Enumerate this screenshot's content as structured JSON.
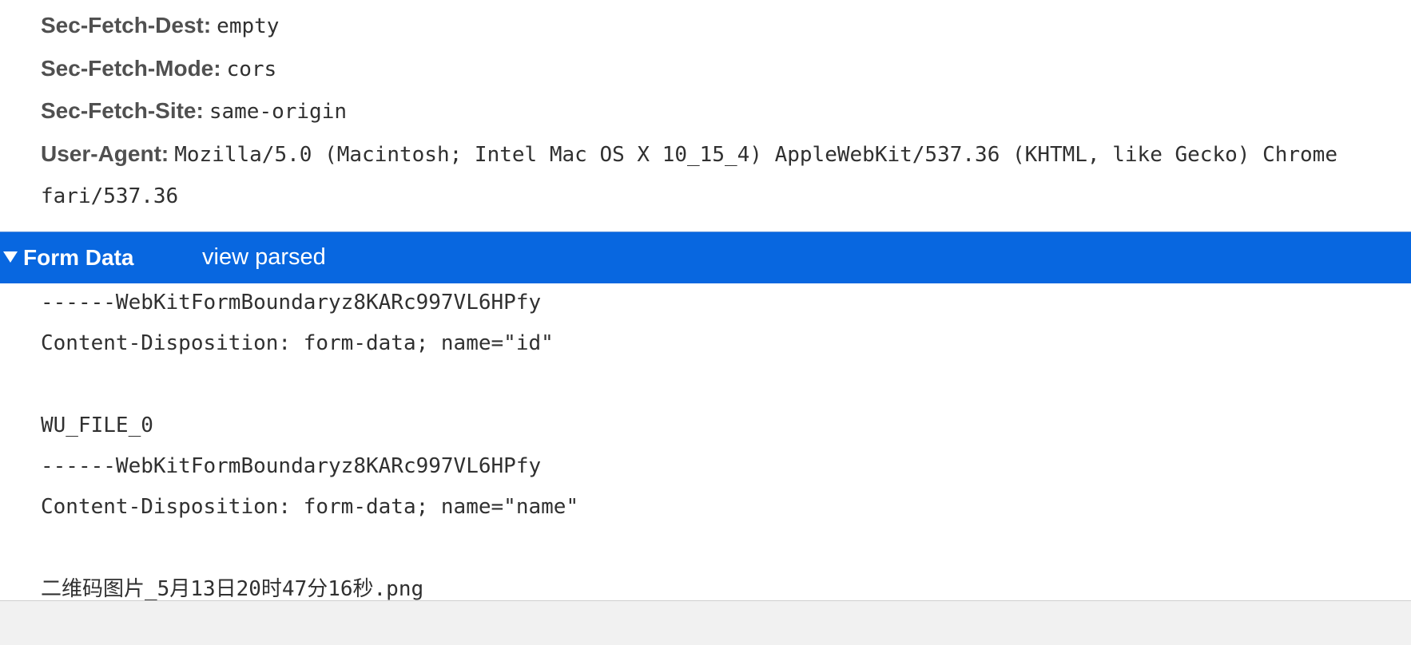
{
  "request_headers": [
    {
      "key": "Sec-Fetch-Dest:",
      "value": "empty"
    },
    {
      "key": "Sec-Fetch-Mode:",
      "value": "cors"
    },
    {
      "key": "Sec-Fetch-Site:",
      "value": "same-origin"
    },
    {
      "key": "User-Agent:",
      "value": "Mozilla/5.0 (Macintosh; Intel Mac OS X 10_15_4) AppleWebKit/537.36 (KHTML, like Gecko) Chrome",
      "continuation": "fari/537.36"
    }
  ],
  "form_data_section": {
    "title": "Form Data",
    "toggle_icon": "triangle-down-icon",
    "view_link": "view parsed",
    "accent_color": "#0867e0",
    "lines": [
      "------WebKitFormBoundaryz8KARc997VL6HPfy",
      "Content-Disposition: form-data; name=\"id\"",
      "",
      "WU_FILE_0",
      "------WebKitFormBoundaryz8KARc997VL6HPfy",
      "Content-Disposition: form-data; name=\"name\"",
      "",
      "二维码图片_5月13日20时47分16秒.png"
    ]
  }
}
